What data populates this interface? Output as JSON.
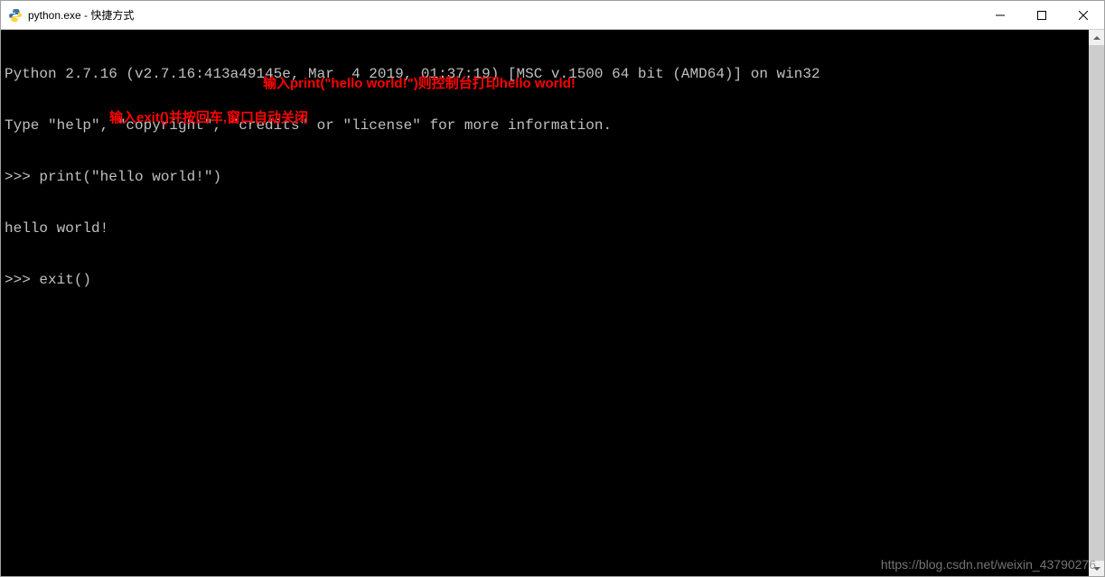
{
  "window": {
    "title": "python.exe - 快捷方式"
  },
  "console": {
    "line1": "Python 2.7.16 (v2.7.16:413a49145e, Mar  4 2019, 01:37:19) [MSC v.1500 64 bit (AMD64)] on win32",
    "line2": "Type \"help\", \"copyright\", \"credits\" or \"license\" for more information.",
    "line3": ">>> print(\"hello world!\")",
    "line4": "hello world!",
    "line5": ">>> exit()"
  },
  "annotations": {
    "anno1": "输入print(\"hello world!\")则控制台打印hello world!",
    "anno2": "输入exit()并按回车,窗口自动关闭"
  },
  "watermark": "https://blog.csdn.net/weixin_43790276"
}
